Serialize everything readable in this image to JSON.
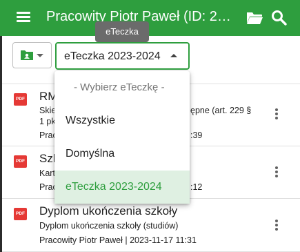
{
  "appbar": {
    "title": "Pracowity Piotr Paweł (ID: 2…"
  },
  "toolbar": {
    "eteczka_value": "eTeczka 2023-2024",
    "tooltip": "eTeczka"
  },
  "dropdown": {
    "placeholder": "- Wybierz eTeczkę -",
    "options": [
      "Wszystkie",
      "Domyślna",
      "eTeczka 2023-2024"
    ],
    "selected_index": 2
  },
  "documents": [
    {
      "icon_label": "PDF",
      "title": "RM",
      "subtitle_right": "ępne (art. 229 §",
      "subtitle_left": "Skie",
      "line2": "1 pk",
      "meta_left": "Prac",
      "meta_right": ":39"
    },
    {
      "icon_label": "PDF",
      "title": "Szk",
      "subtitle_left": "Kart",
      "meta_left": "Prac",
      "meta_right": ":12"
    },
    {
      "icon_label": "PDF",
      "title": "Dyplom ukończenia szkoły",
      "subtitle": "Dyplom ukończenia szkoły (studiów)",
      "meta": "Pracowity Piotr Paweł | 2023-11-17 11:31"
    }
  ],
  "colors": {
    "brand": "#2e9e3e",
    "selected_bg": "#dff0e2",
    "pdf_red": "#e53935"
  },
  "icons": [
    "menu-icon",
    "folder-open-icon",
    "search-icon",
    "account-box-icon",
    "pdf-icon",
    "more-vert-icon"
  ]
}
